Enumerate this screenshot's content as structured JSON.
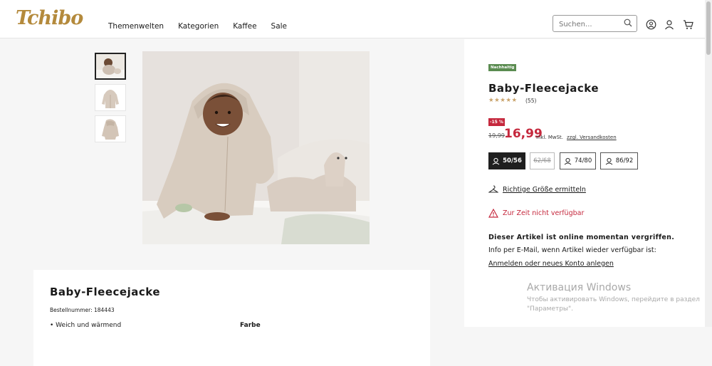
{
  "header": {
    "logo": "Tchibo",
    "nav": [
      "Themenwelten",
      "Kategorien",
      "Kaffee",
      "Sale"
    ],
    "search_placeholder": "Suchen..."
  },
  "product": {
    "badge": "Nachhaltig",
    "title": "Baby-Fleecejacke",
    "rating": 5,
    "stars": "★★★★★",
    "review_count": "(55)",
    "discount": "-15 %",
    "old_price": "19,99",
    "price": "16,99",
    "vat": "inkl. MwSt.",
    "shipping": "zzgl. Versandkosten",
    "sizes": [
      {
        "label": "50/56",
        "state": "selected"
      },
      {
        "label": "62/68",
        "state": "disabled"
      },
      {
        "label": "74/80",
        "state": "available"
      },
      {
        "label": "86/92",
        "state": "available"
      }
    ],
    "fit_link": "Richtige Größe ermitteln",
    "availability": "Zur Zeit nicht verfügbar",
    "oos_title": "Dieser Artikel ist online momentan vergriffen.",
    "oos_info": "Info per E-Mail, wenn Artikel wieder verfügbar ist:",
    "oos_login": "Anmelden oder neues Konto anlegen"
  },
  "details": {
    "title": "Baby-Fleecejacke",
    "order_number": "Bestellnummer: 184443",
    "bullet": "• Weich und wärmend",
    "farbe_label": "Farbe"
  },
  "watermark": {
    "line1": "Активация Windows",
    "line2": "Чтобы активировать Windows, перейдите в раздел",
    "line3": "\"Параметры\"."
  },
  "colors": {
    "brand": "#b48a3c",
    "sale": "#c5283d",
    "sustainable": "#5b8c51"
  }
}
